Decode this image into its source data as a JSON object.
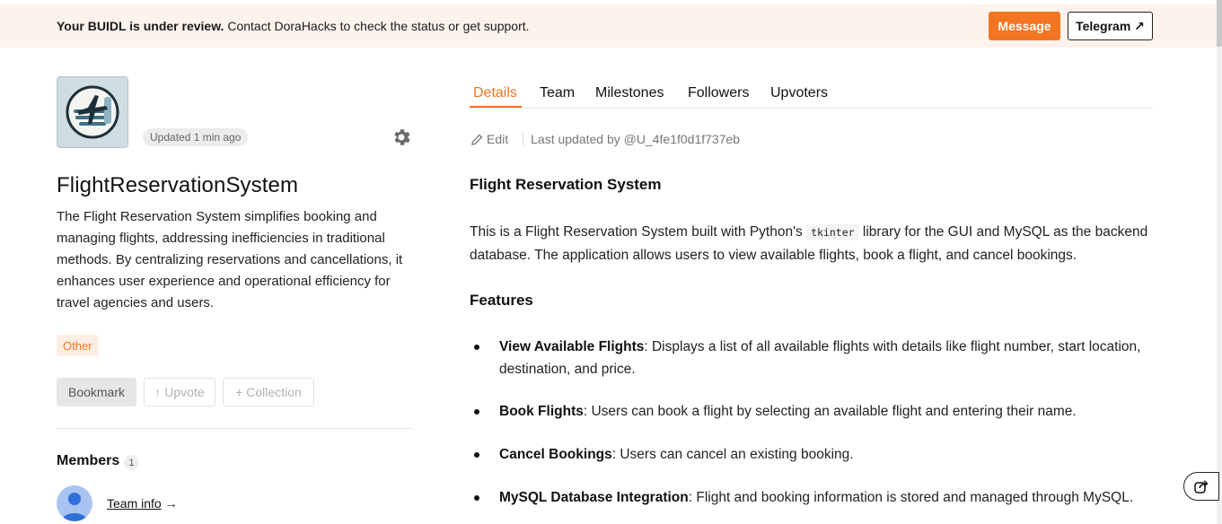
{
  "banner": {
    "status_bold": "Your BUIDL is under review.",
    "status_rest": " Contact DoraHacks to check the status or get support.",
    "message_label": "Message",
    "telegram_label": "Telegram ↗"
  },
  "project": {
    "updated": "Updated 1 min ago",
    "title": "FlightReservationSystem",
    "description": "The Flight Reservation System simplifies booking and managing flights, addressing inefficiencies in traditional methods. By centralizing reservations and cancellations, it enhances user experience and operational efficiency for travel agencies and users.",
    "tag": "Other",
    "bookmark_label": "Bookmark",
    "upvote_label": "↑ Upvote",
    "collection_label": "+ Collection"
  },
  "members": {
    "title": "Members",
    "count": "1",
    "team_info": "Team info",
    "arrow": " →"
  },
  "tabs": [
    {
      "label": "Details"
    },
    {
      "label": "Team"
    },
    {
      "label": "Milestones"
    },
    {
      "label": "Followers"
    },
    {
      "label": "Upvoters"
    }
  ],
  "edit_row": {
    "edit_label": "Edit",
    "last_updated": "Last updated by @U_4fe1f0d1f737eb"
  },
  "content": {
    "heading": "Flight Reservation System",
    "intro_before": "This is a Flight Reservation System built with Python's ",
    "intro_code": "tkinter",
    "intro_after": " library for the GUI and MySQL as the backend database. The application allows users to view available flights, book a flight, and cancel bookings.",
    "features_heading": "Features",
    "features": [
      {
        "title": "View Available Flights",
        "text": ": Displays a list of all available flights with details like flight number, start location, destination, and price."
      },
      {
        "title": "Book Flights",
        "text": ": Users can book a flight by selecting an available flight and entering their name."
      },
      {
        "title": "Cancel Bookings",
        "text": ": Users can cancel an existing booking."
      },
      {
        "title": "MySQL Database Integration",
        "text": ": Flight and booking information is stored and managed through MySQL."
      }
    ]
  },
  "colors": {
    "accent": "#f47521",
    "banner_bg": "#fdf3ec",
    "tag_bg": "#fdeee4"
  },
  "icons": {
    "logo": "airplane-stack-logo",
    "settings": "gear-icon",
    "edit": "pencil-icon",
    "share": "share-icon",
    "avatar": "user-avatar-icon"
  }
}
